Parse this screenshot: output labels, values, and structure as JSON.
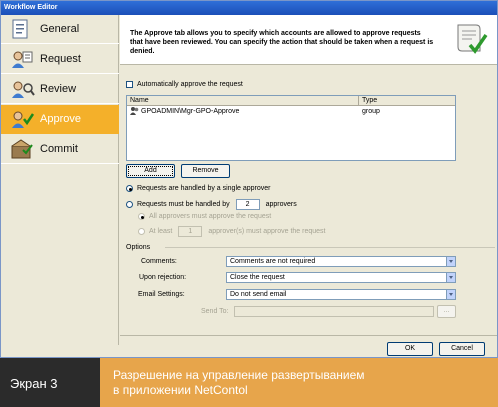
{
  "window": {
    "title": "Workflow Editor"
  },
  "sidebar": {
    "items": [
      {
        "label": "General",
        "icon": "general-icon",
        "active": false
      },
      {
        "label": "Request",
        "icon": "request-icon",
        "active": false
      },
      {
        "label": "Review",
        "icon": "review-icon",
        "active": false
      },
      {
        "label": "Approve",
        "icon": "approve-icon",
        "active": true
      },
      {
        "label": "Commit",
        "icon": "commit-icon",
        "active": false
      }
    ]
  },
  "header": {
    "description": "The Approve tab allows you to specify which accounts are allowed to approve requests that have been reviewed.  You can specify the action that should be taken when a request is denied.",
    "icon": "scroll-check-icon"
  },
  "auto_approve": {
    "label": "Automatically approve the request",
    "checked": false
  },
  "list": {
    "columns": [
      "Name",
      "Type"
    ],
    "rows": [
      {
        "name": "GPOADMIN\\Mgr-GPO-Approve",
        "type": "group"
      }
    ]
  },
  "buttons": {
    "add": "Add",
    "remove": "Remove",
    "ok": "OK",
    "cancel": "Cancel",
    "browse": "..."
  },
  "approvers": {
    "single": "Requests are handled by a single approver",
    "multi_prefix": "Requests must be handled by",
    "multi_count": "2",
    "multi_suffix": "approvers",
    "all": "All approvers must approve the request",
    "atleast_prefix": "At least",
    "atleast_count": "1",
    "atleast_suffix": "approver(s) must approve the request"
  },
  "options": {
    "section_label": "Options",
    "comments_label": "Comments:",
    "comments_value": "Comments are not required",
    "rejection_label": "Upon rejection:",
    "rejection_value": "Close the request",
    "email_label": "Email Settings:",
    "email_value": "Do not send email",
    "sendto_label": "Send To:",
    "sendto_value": ""
  },
  "caption": {
    "left": "Экран 3",
    "right_line1": "Разрешение на управление развертыванием",
    "right_line2": "в приложении NetContol"
  },
  "colors": {
    "active_tab": "#f4b02a",
    "caption_left": "#2b2b2b",
    "caption_right": "#e7a54b"
  }
}
